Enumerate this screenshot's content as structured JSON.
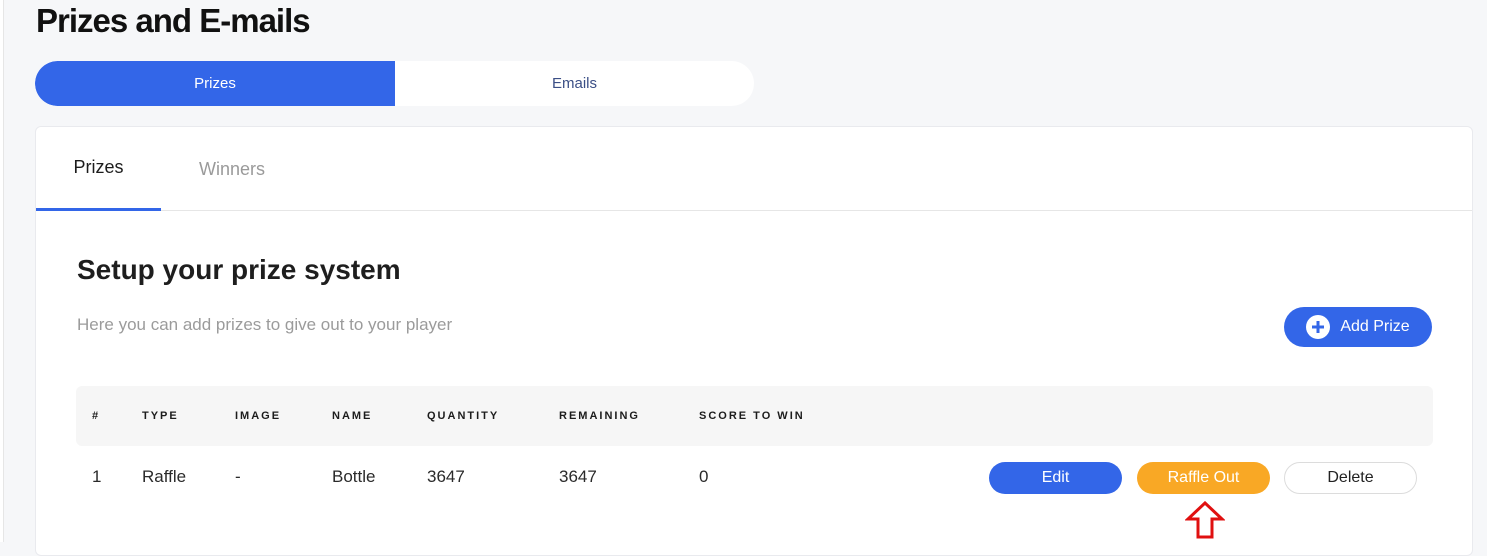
{
  "page": {
    "title": "Prizes and E-mails"
  },
  "toggle": {
    "options": [
      {
        "label": "Prizes",
        "active": true
      },
      {
        "label": "Emails",
        "active": false
      }
    ]
  },
  "tabs": [
    {
      "label": "Prizes",
      "active": true
    },
    {
      "label": "Winners",
      "active": false
    }
  ],
  "section": {
    "title": "Setup your prize system",
    "subtitle": "Here you can add prizes to give out to your player",
    "add_button_label": "Add Prize"
  },
  "table": {
    "columns": [
      "#",
      "TYPE",
      "IMAGE",
      "NAME",
      "QUANTITY",
      "REMAINING",
      "SCORE TO WIN"
    ],
    "rows": [
      {
        "num": "1",
        "type": "Raffle",
        "image": "-",
        "name": "Bottle",
        "quantity": "3647",
        "remaining": "3647",
        "score_to_win": "0",
        "actions": {
          "edit": "Edit",
          "raffle_out": "Raffle Out",
          "delete": "Delete"
        }
      }
    ]
  },
  "colors": {
    "primary": "#3366e8",
    "raffle": "#f9a825",
    "annotation_arrow": "#e01010"
  },
  "icons": {
    "add": "plus-circle-icon",
    "annotation": "arrow-up-outline-icon"
  }
}
